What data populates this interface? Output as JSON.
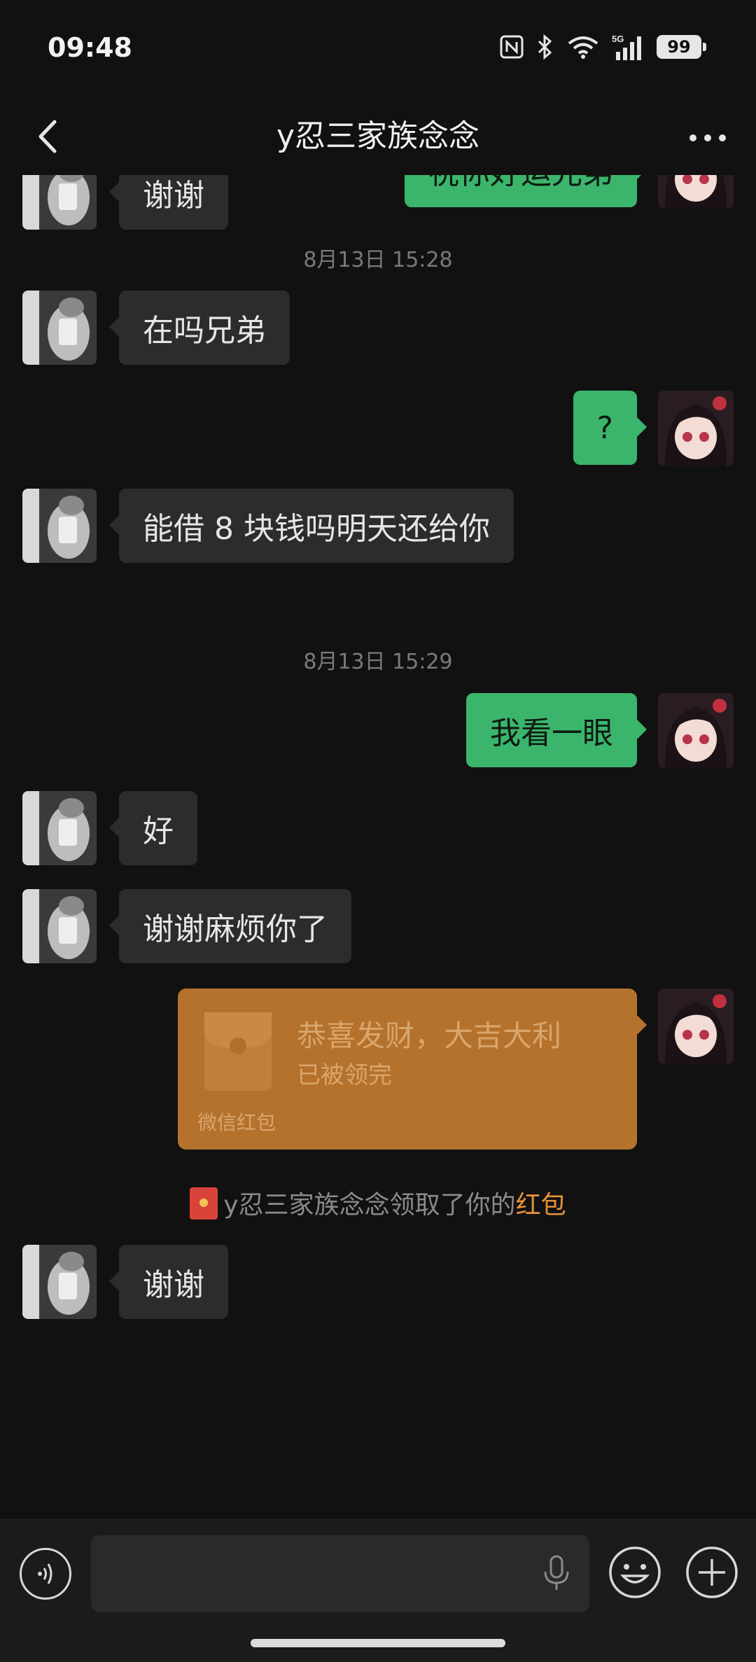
{
  "status": {
    "time": "09:48",
    "battery": "99",
    "network": "5G"
  },
  "header": {
    "title": "y忍三家族念念"
  },
  "messages": {
    "m0": "祝你好运兄弟",
    "m1": "谢谢",
    "ts1": "8月13日 15:28",
    "m2": "在吗兄弟",
    "m3": "?",
    "m4": "能借 8 块钱吗明天还给你",
    "ts2": "8月13日 15:29",
    "m5": "我看一眼",
    "m6": "好",
    "m7": "谢谢麻烦你了",
    "m8": "谢谢"
  },
  "redpacket": {
    "title": "恭喜发财，大吉大利",
    "status": "已被领完",
    "footer": "微信红包"
  },
  "system_note": {
    "text": "y忍三家族念念领取了你的",
    "link": "红包"
  },
  "colors": {
    "outgoing": "#3bb56c",
    "incoming": "#2c2c2c",
    "redpacket": "#b5722d",
    "link": "#e8923a"
  },
  "icons": [
    "back-icon",
    "more-icon",
    "voice-icon",
    "mic-icon",
    "emoji-icon",
    "plus-icon",
    "nfc-icon",
    "bluetooth-icon",
    "wifi-icon",
    "signal-icon"
  ]
}
